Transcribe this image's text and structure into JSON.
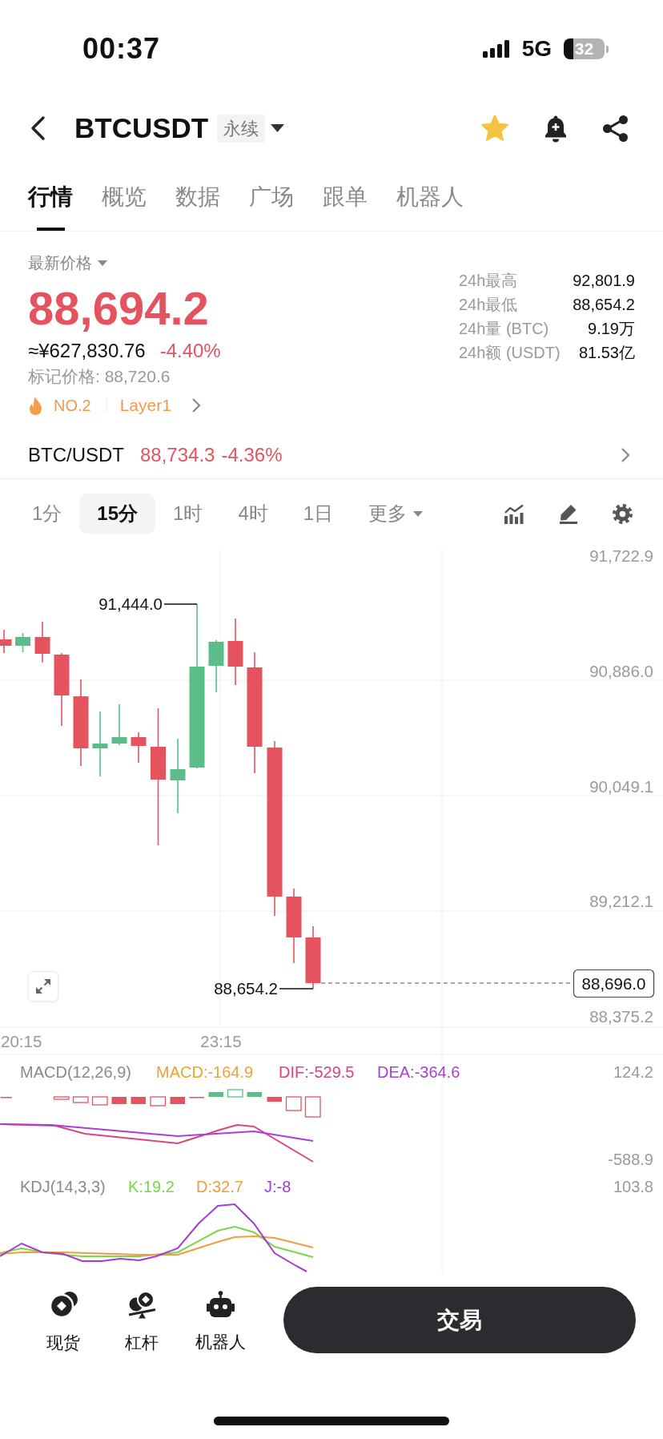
{
  "status_bar": {
    "time": "00:37",
    "network": "5G",
    "battery": "32"
  },
  "header": {
    "symbol": "BTCUSDT",
    "contract_type": "永续",
    "favorite": true
  },
  "tabs": [
    {
      "label": "行情",
      "selected": true
    },
    {
      "label": "概览",
      "selected": false
    },
    {
      "label": "数据",
      "selected": false
    },
    {
      "label": "广场",
      "selected": false
    },
    {
      "label": "跟单",
      "selected": false
    },
    {
      "label": "机器人",
      "selected": false
    }
  ],
  "price": {
    "label": "最新价格",
    "last": "88,694.2",
    "falling": true,
    "approx_cny": "≈¥627,830.76",
    "change": "-4.40%",
    "mark_price": "标记价格: 88,720.6",
    "rank": "NO.2",
    "sector": "Layer1"
  },
  "stats": [
    {
      "label": "24h最高",
      "value": "92,801.9"
    },
    {
      "label": "24h最低",
      "value": "88,654.2"
    },
    {
      "label": "24h量 (BTC)",
      "value": "9.19万"
    },
    {
      "label": "24h额 (USDT)",
      "value": "81.53亿"
    }
  ],
  "spot": {
    "pair": "BTC/USDT",
    "price": "88,734.3",
    "change": "-4.36%",
    "falling": true
  },
  "intervals": [
    {
      "label": "1分",
      "kind": "option",
      "selected": false
    },
    {
      "label": "15分",
      "kind": "option",
      "selected": true
    },
    {
      "label": "1时",
      "kind": "option",
      "selected": false
    },
    {
      "label": "4时",
      "kind": "option",
      "selected": false
    },
    {
      "label": "1日",
      "kind": "option",
      "selected": false
    },
    {
      "label": "更多",
      "kind": "menu",
      "selected": false
    }
  ],
  "chart": {
    "price_axis": [
      "91,722.9",
      "90,886.0",
      "90,049.1",
      "89,212.1",
      "88,375.2"
    ],
    "time_axis": [
      "20:15",
      "23:15"
    ],
    "high_marker": "91,444.0",
    "low_marker": "88,654.2",
    "last_price": "88,696.0"
  },
  "macd": {
    "title": "MACD(12,26,9)",
    "legend": [
      {
        "label": "MACD:-164.9",
        "color": "#eea236"
      },
      {
        "label": "DIF:-529.5",
        "color": "#d9457f"
      },
      {
        "label": "DEA:-364.6",
        "color": "#a93fd8"
      }
    ],
    "axis": [
      "124.2",
      "-588.9"
    ]
  },
  "kdj": {
    "title": "KDJ(14,3,3)",
    "legend": [
      {
        "label": "K:19.2",
        "color": "#7ad54f"
      },
      {
        "label": "D:32.7",
        "color": "#ee9d3f"
      },
      {
        "label": "J:-8",
        "color": "#a43ad6"
      }
    ],
    "axis": [
      "103.8"
    ]
  },
  "bottom_nav": [
    {
      "label": "现货"
    },
    {
      "label": "杠杆"
    },
    {
      "label": "机器人"
    }
  ],
  "trade_button": "交易"
}
